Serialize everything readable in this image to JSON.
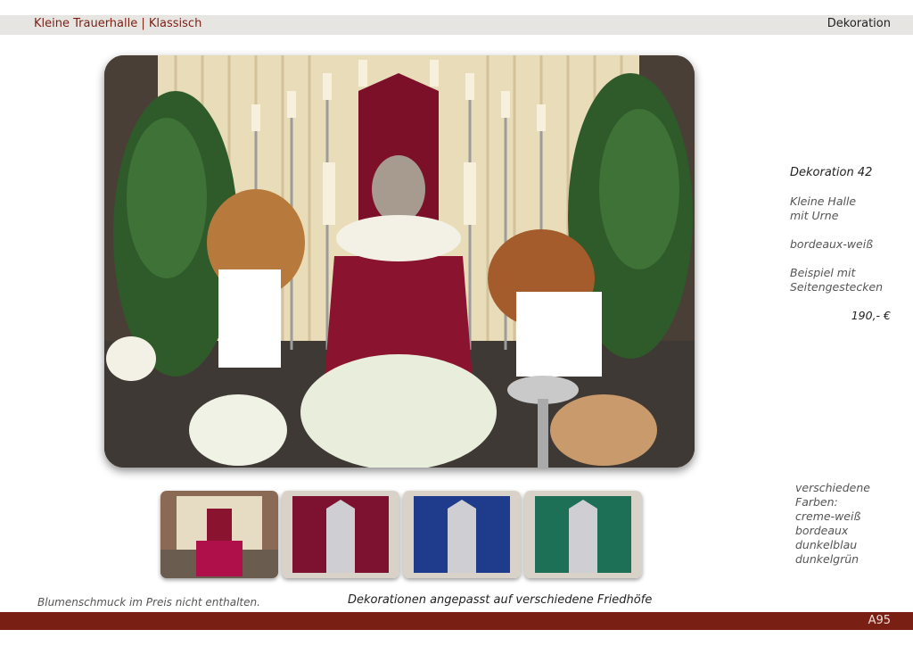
{
  "header": {
    "left": "Kleine Trauerhalle  |  Klassisch",
    "right": "Dekoration"
  },
  "info": {
    "title": "Dekoration 42",
    "hall": "Kleine Halle\nmit Urne",
    "color": "bordeaux-weiß",
    "example": "Beispiel mit\nSeitengestecken",
    "price": "190,- €"
  },
  "colors_text": "verschiedene\nFarben:\ncreme-weiß\nbordeaux\ndunkelblau\ndunkelgrün",
  "thumbnails": [
    {
      "name": "creme-weiß",
      "color": "#e6dcc4"
    },
    {
      "name": "bordeaux",
      "color": "#7d1230"
    },
    {
      "name": "dunkelblau",
      "color": "#1f3b8c"
    },
    {
      "name": "dunkelgrün",
      "color": "#1d6f55"
    }
  ],
  "footer": {
    "note_left": "Blumenschmuck im Preis nicht enthalten.",
    "note_center": "Dekorationen angepasst auf verschiedene Friedhöfe",
    "page": "A95"
  },
  "colors": {
    "accent": "#7a1f14",
    "topbar": "#e7e5e2"
  }
}
